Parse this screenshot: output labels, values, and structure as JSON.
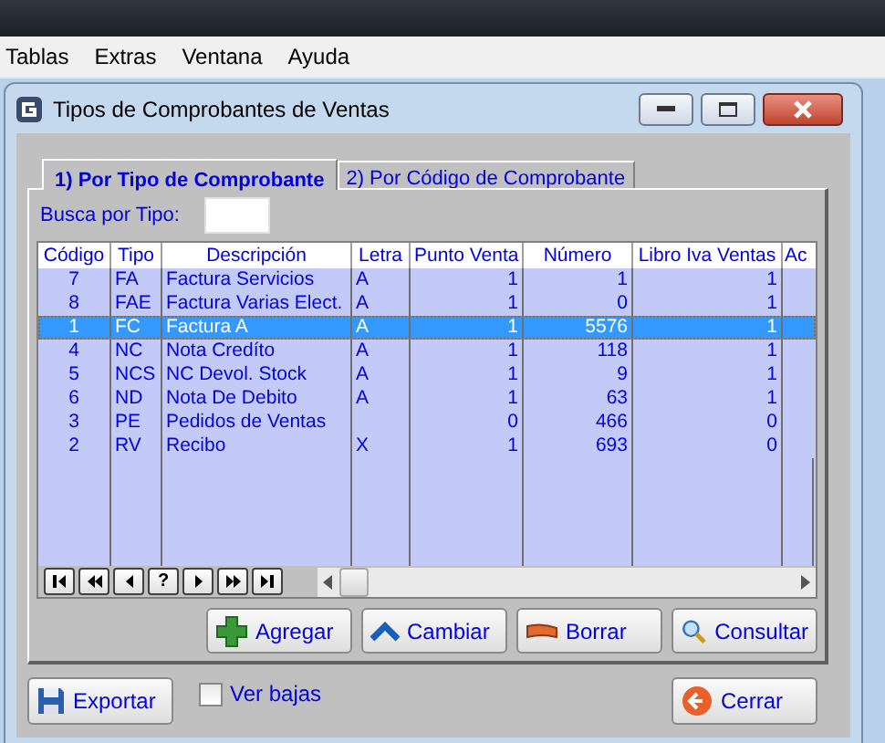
{
  "menu": [
    "Tablas",
    "Extras",
    "Ventana",
    "Ayuda"
  ],
  "window": {
    "title": "Tipos de Comprobantes de Ventas"
  },
  "tabs": [
    {
      "label": "1) Por Tipo de Comprobante",
      "selected": true
    },
    {
      "label": "2) Por Código de Comprobante",
      "selected": false
    }
  ],
  "search": {
    "label": "Busca por Tipo:"
  },
  "table": {
    "columns": [
      {
        "label": "Código"
      },
      {
        "label": "Tipo"
      },
      {
        "label": "Descripción"
      },
      {
        "label": "Letra"
      },
      {
        "label": "Punto Venta"
      },
      {
        "label": "Número"
      },
      {
        "label": "Libro Iva Ventas"
      },
      {
        "label": "Ac"
      }
    ],
    "rows": [
      {
        "selected": false,
        "cells": [
          "7",
          "FA",
          "Factura Servicios",
          "A",
          "1",
          "1",
          "1"
        ]
      },
      {
        "selected": false,
        "cells": [
          "8",
          "FAE",
          "Factura Varias Elect.",
          "A",
          "1",
          "0",
          "1"
        ]
      },
      {
        "selected": true,
        "cells": [
          "1",
          "FC",
          "Factura A",
          "A",
          "1",
          "5576",
          "1"
        ]
      },
      {
        "selected": false,
        "cells": [
          "4",
          "NC",
          "Nota Credíto",
          "A",
          "1",
          "118",
          "1"
        ]
      },
      {
        "selected": false,
        "cells": [
          "5",
          "NCS",
          "NC Devol. Stock",
          "A",
          "1",
          "9",
          "1"
        ]
      },
      {
        "selected": false,
        "cells": [
          "6",
          "ND",
          "Nota De Debito",
          "A",
          "1",
          "63",
          "1"
        ]
      },
      {
        "selected": false,
        "cells": [
          "3",
          "PE",
          "Pedidos de Ventas",
          "",
          "0",
          "466",
          "0"
        ]
      },
      {
        "selected": false,
        "cells": [
          "2",
          "RV",
          "Recibo",
          "X",
          "1",
          "693",
          "0"
        ]
      }
    ]
  },
  "navigator": [
    {
      "kind": "first"
    },
    {
      "kind": "prior-page"
    },
    {
      "kind": "prior"
    },
    {
      "kind": "help",
      "label": "?"
    },
    {
      "kind": "next"
    },
    {
      "kind": "next-page"
    },
    {
      "kind": "last"
    }
  ],
  "actions": [
    {
      "kind": "add",
      "label": "Agregar"
    },
    {
      "kind": "edit",
      "label": "Cambiar"
    },
    {
      "kind": "delete",
      "label": "Borrar"
    },
    {
      "kind": "search",
      "label": "Consultar"
    }
  ],
  "export_button": "Exportar",
  "show_deleted": {
    "label": "Ver bajas",
    "checked": false
  },
  "close_button": "Cerrar"
}
